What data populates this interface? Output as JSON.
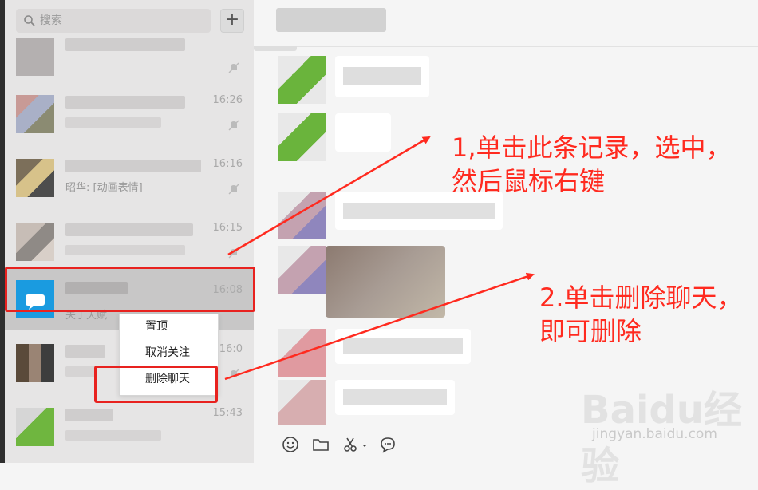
{
  "search": {
    "placeholder": "搜索"
  },
  "add_button": {
    "label": "+"
  },
  "chats": [
    {
      "time": ""
    },
    {
      "time": "16:26"
    },
    {
      "time": "16:16",
      "preview": "昭华: [动画表情]"
    },
    {
      "time": "16:15"
    },
    {
      "time": "16:08",
      "preview": "关于天赋"
    },
    {
      "time": "16:0"
    },
    {
      "time": "15:43"
    }
  ],
  "context_menu": {
    "items": [
      "置顶",
      "取消关注",
      "删除聊天"
    ]
  },
  "annotations": {
    "step1_line1": "1,单击此条记录，选中，",
    "step1_line2": "然后鼠标右键",
    "step2_line1": "2.单击删除聊天，",
    "step2_line2": "即可删除"
  },
  "watermark": {
    "brand": "Baidu经验",
    "url": "jingyan.baidu.com"
  },
  "colors": {
    "annotation": "#ff2a1f",
    "selected_row": "#c8c7c7",
    "sidebar": "#e6e5e5"
  }
}
